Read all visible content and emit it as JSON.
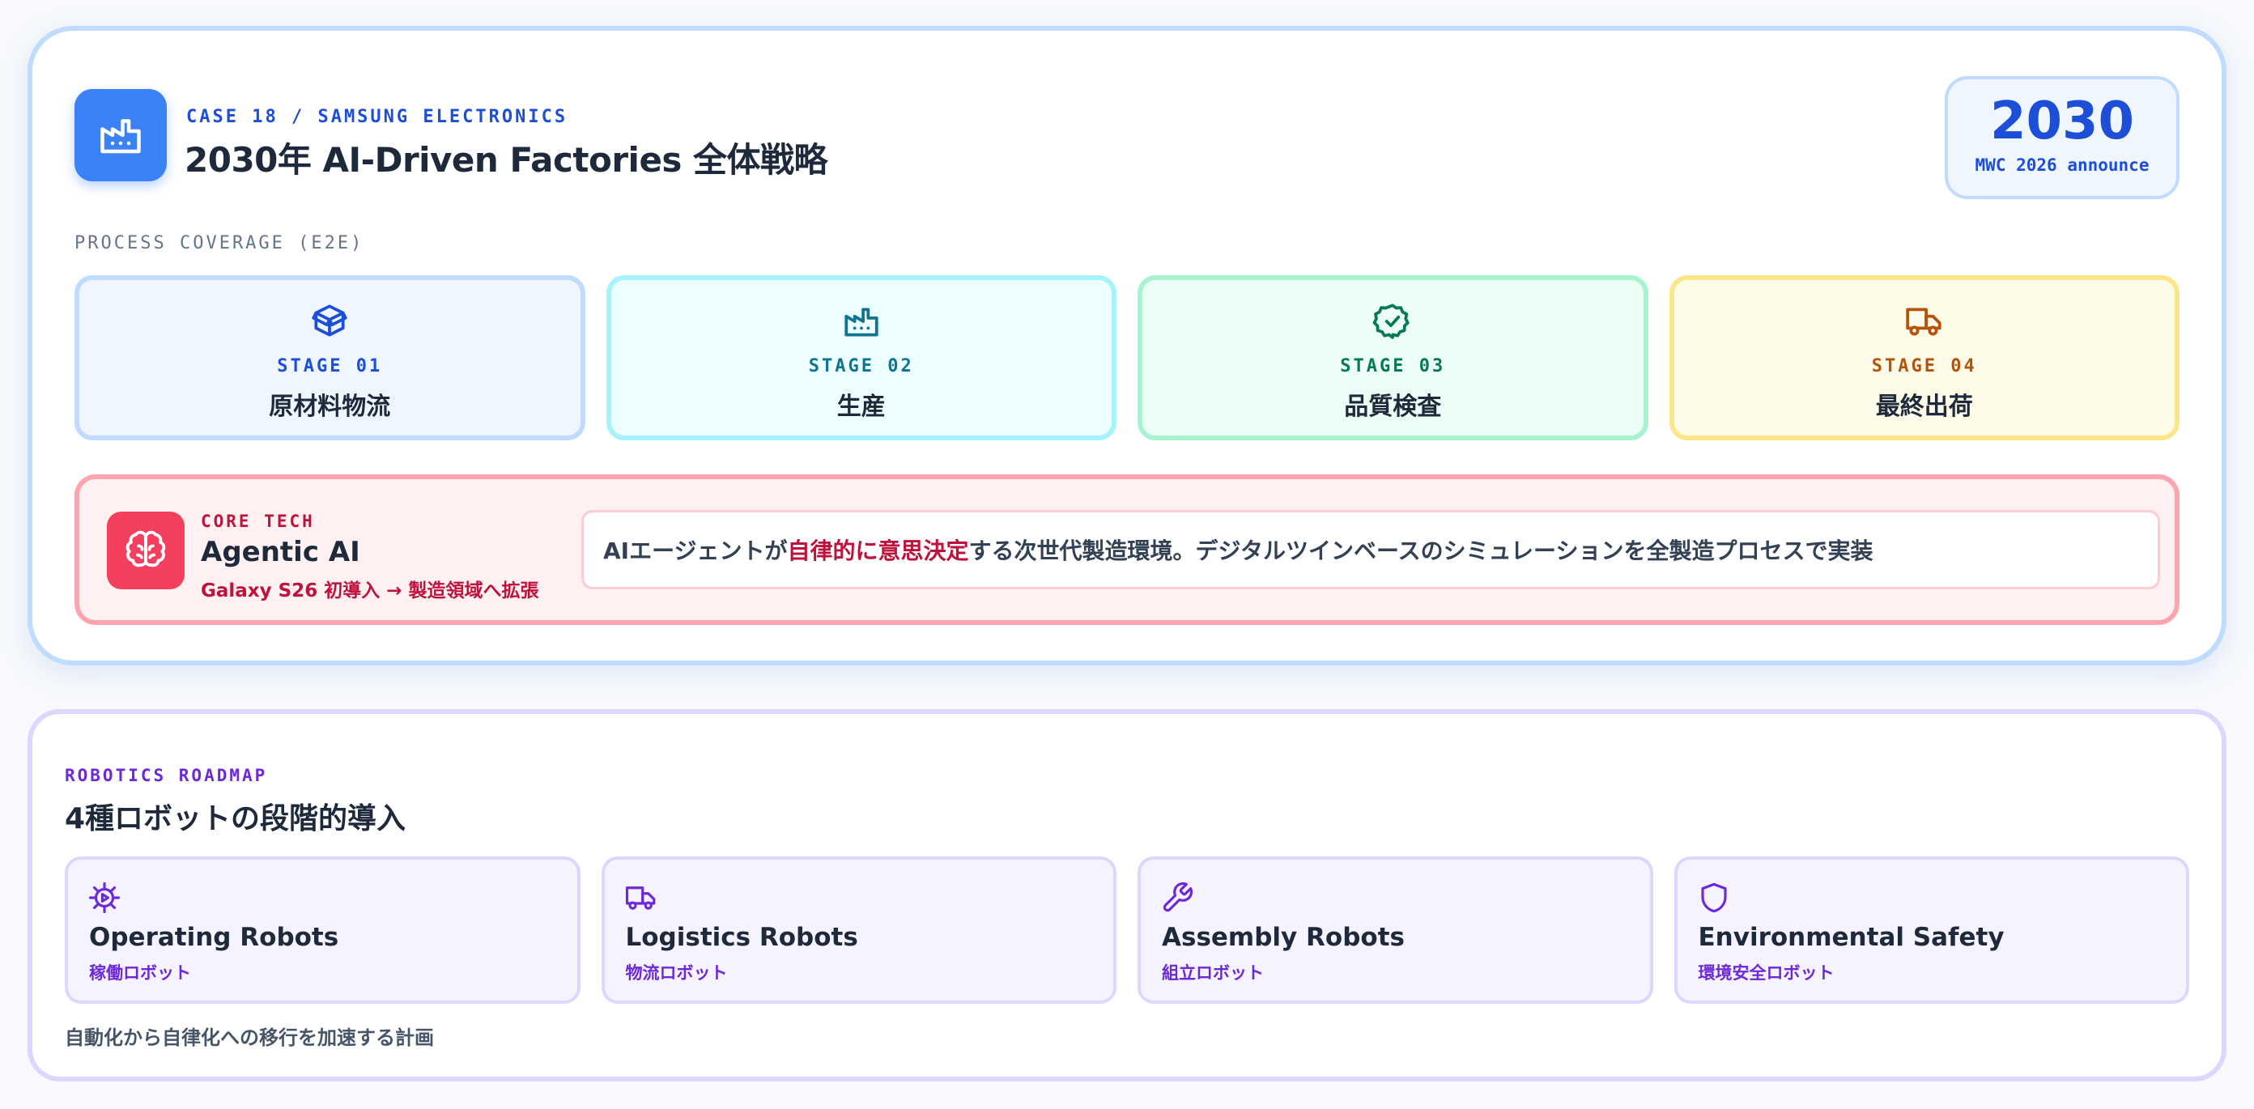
{
  "header": {
    "eyebrow": "CASE 18 / SAMSUNG ELECTRONICS",
    "title": "2030年 AI-Driven Factories 全体戦略",
    "logo_icon": "factory-icon",
    "year": "2030",
    "year_sub": "MWC 2026 announce"
  },
  "coverage": {
    "label": "PROCESS COVERAGE (E2E)",
    "stages": [
      {
        "num": "STAGE 01",
        "name": "原材料物流",
        "icon": "package-icon",
        "color": "#1d4ed8"
      },
      {
        "num": "STAGE 02",
        "name": "生産",
        "icon": "factory-icon",
        "color": "#0e7490"
      },
      {
        "num": "STAGE 03",
        "name": "品質検査",
        "icon": "badge-check-icon",
        "color": "#047857"
      },
      {
        "num": "STAGE 04",
        "name": "最終出荷",
        "icon": "truck-icon",
        "color": "#b45309"
      }
    ]
  },
  "core": {
    "eyebrow": "CORE TECH",
    "title": "Agentic AI",
    "subtitle": "Galaxy S26 初導入 → 製造領域へ拡張",
    "icon": "brain-icon",
    "desc_before": "AIエージェントが",
    "desc_highlight": "自律的に意思決定",
    "desc_after": "する次世代製造環境。デジタルツインベースのシミュレーションを全製造プロセスで実装",
    "accent": "#be123c"
  },
  "robotics": {
    "eyebrow": "ROBOTICS ROADMAP",
    "title": "4種ロボットの段階的導入",
    "items": [
      {
        "name": "Operating Robots",
        "sub": "稼働ロボット",
        "icon": "gear-icon"
      },
      {
        "name": "Logistics Robots",
        "sub": "物流ロボット",
        "icon": "truck-icon"
      },
      {
        "name": "Assembly Robots",
        "sub": "組立ロボット",
        "icon": "wrench-icon"
      },
      {
        "name": "Environmental Safety",
        "sub": "環境安全ロボット",
        "icon": "shield-icon"
      }
    ],
    "footer": "自動化から自律化への移行を加速する計画",
    "accent": "#6d28d9"
  }
}
